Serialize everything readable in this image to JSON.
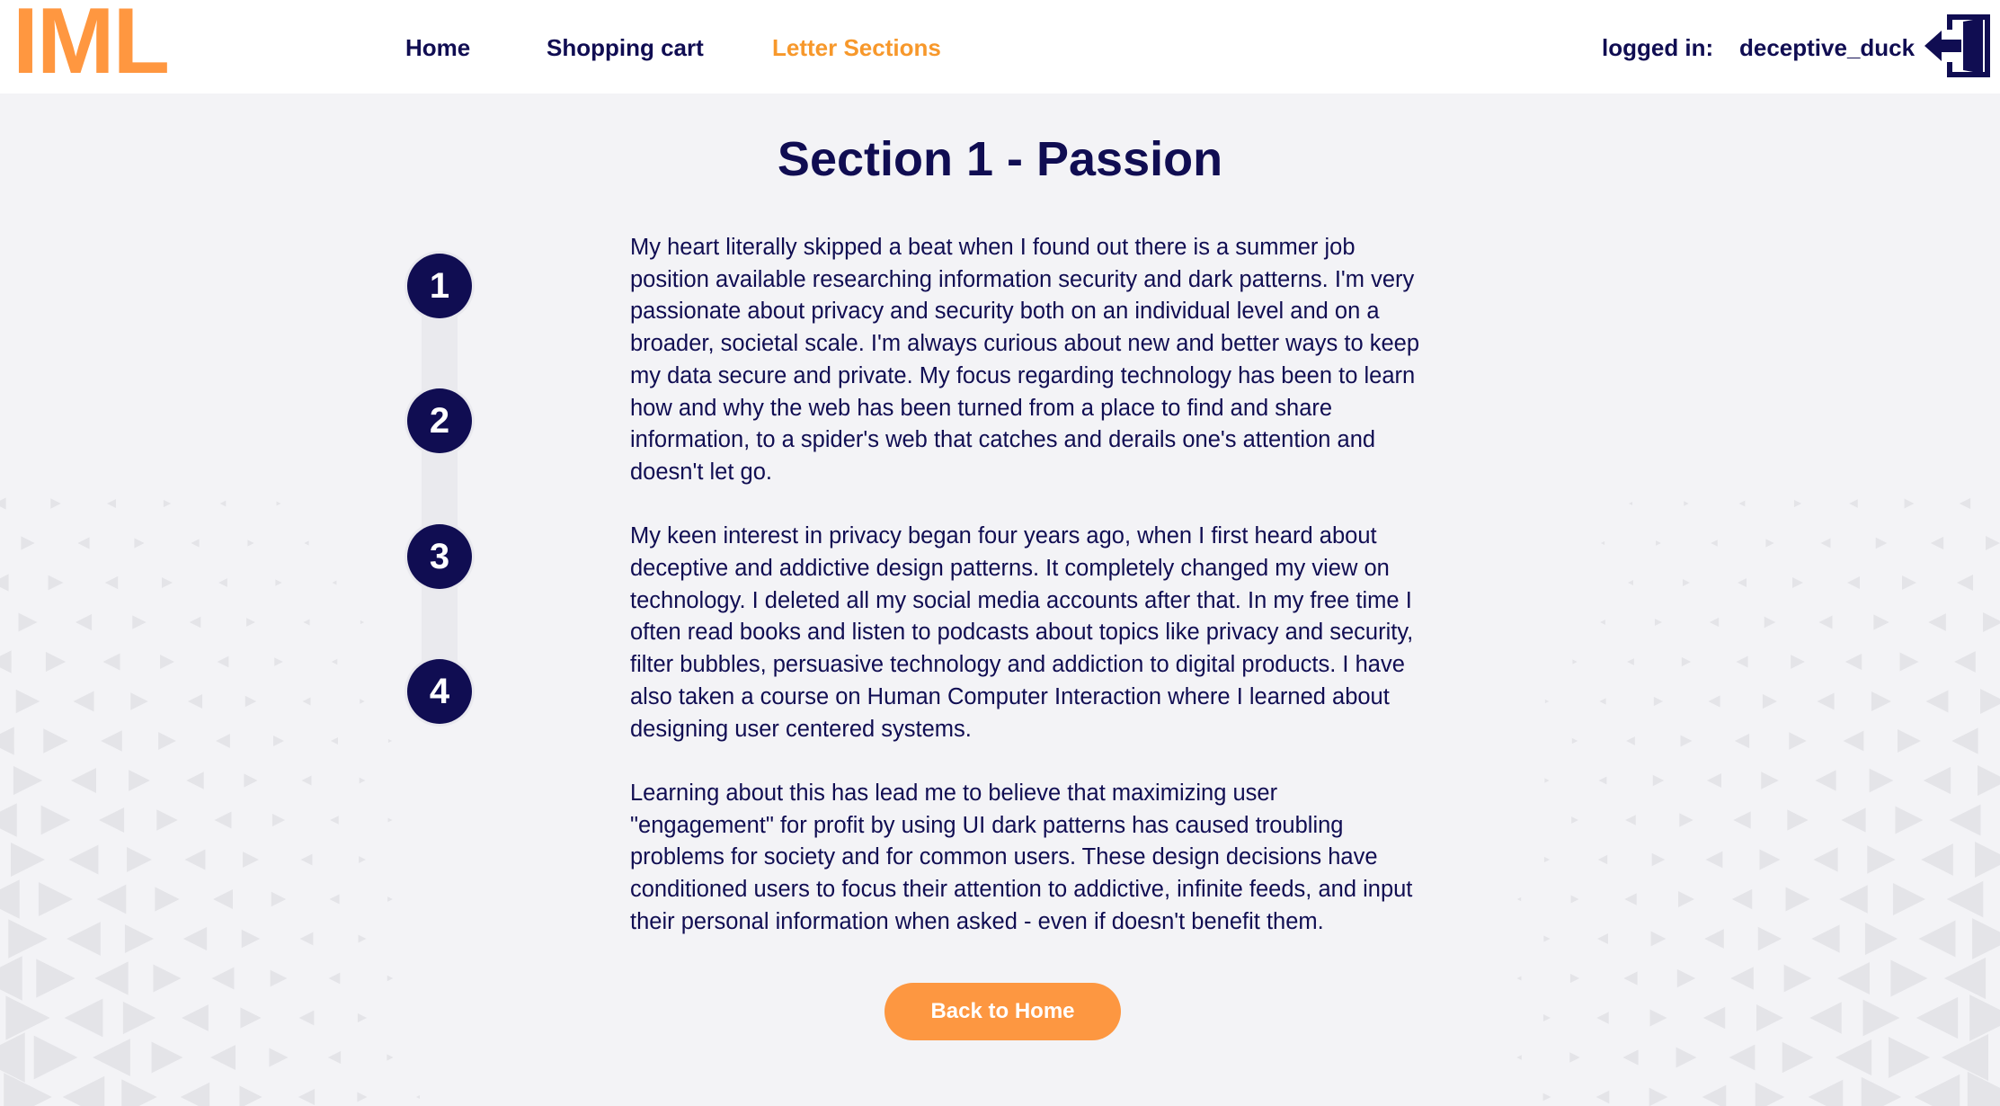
{
  "brand": {
    "logo_text": "IML",
    "accent_color": "#ff9740",
    "primary_color": "#100d52"
  },
  "nav": {
    "items": [
      {
        "label": "Home"
      },
      {
        "label": "Shopping cart"
      },
      {
        "label": "Letter Sections",
        "active": true
      }
    ]
  },
  "user": {
    "logged_in_label": "logged in:",
    "username": "deceptive_duck",
    "logout_icon": "logout-door-icon"
  },
  "section": {
    "title": "Section 1 - Passion",
    "steps": [
      "1",
      "2",
      "3",
      "4"
    ],
    "paragraphs": [
      "My heart literally skipped a beat when I found out there is a summer job position available researching information security and dark patterns. I'm very passionate about privacy and security both on an individual level and on a broader, societal scale. I'm always curious about new and better ways to keep my data secure and private. My focus regarding technology has been to learn how and why the web has been turned from a place to find and share information, to a spider's web that catches and derails one's attention and doesn't let go.",
      "My keen interest in privacy began four years ago, when I first heard about deceptive and addictive design patterns. It completely changed my view on technology. I deleted all my social media accounts after that. In my free time I often read books and listen to podcasts about topics like privacy and security, filter bubbles, persuasive technology and addiction to digital products. I have also taken a course on Human Computer Interaction where I learned about designing user centered systems.",
      "Learning about this has lead me to believe that maximizing user \"engagement\" for profit by using UI dark patterns has caused troubling problems for society and for common users. These design decisions have conditioned users to focus their attention to addictive, infinite feeds, and input their personal information when asked - even if doesn't benefit them."
    ],
    "back_button_label": "Back to Home"
  }
}
